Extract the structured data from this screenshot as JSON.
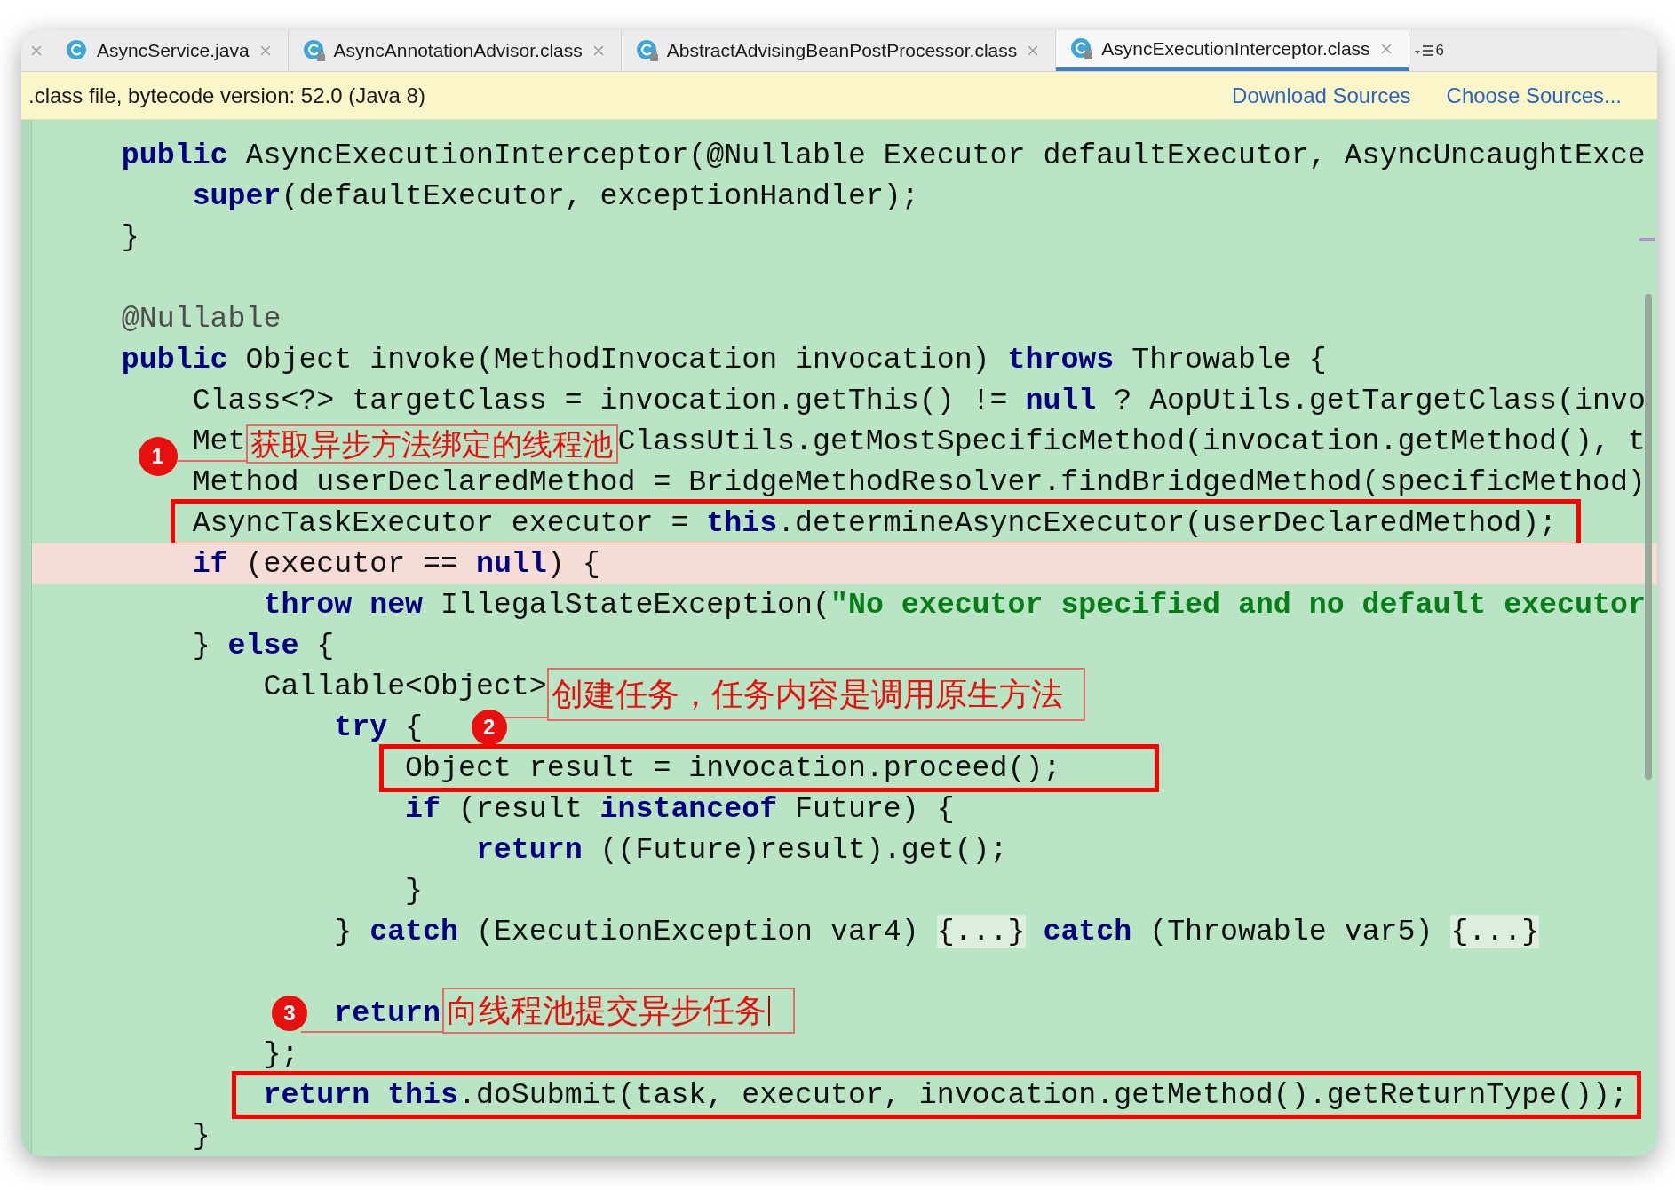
{
  "tabs": [
    {
      "label": "AsyncService.java",
      "selected": false,
      "locked": false
    },
    {
      "label": "AsyncAnnotationAdvisor.class",
      "selected": false,
      "locked": true
    },
    {
      "label": "AbstractAdvisingBeanPostProcessor.class",
      "selected": false,
      "locked": true
    },
    {
      "label": "AsyncExecutionInterceptor.class",
      "selected": true,
      "locked": true
    }
  ],
  "hidden_tab_count": "6",
  "info_bar": {
    "message": ".class file, bytecode version: 52.0 (Java 8)",
    "links": [
      "Download Sources",
      "Choose Sources..."
    ]
  },
  "code_lines": [
    {
      "highlighted": false,
      "boxed": false,
      "tokens": [
        {
          "kind": "kw",
          "text": "    public"
        },
        {
          "kind": "plain",
          "text": " AsyncExecutionInterceptor(@Nullable Executor defaultExecutor, AsyncUncaughtExce"
        }
      ]
    },
    {
      "highlighted": false,
      "boxed": false,
      "tokens": [
        {
          "kind": "kw",
          "text": "        super"
        },
        {
          "kind": "plain",
          "text": "(defaultExecutor, exceptionHandler);"
        }
      ]
    },
    {
      "highlighted": false,
      "boxed": false,
      "tokens": [
        {
          "kind": "plain",
          "text": "    }"
        }
      ]
    },
    {
      "kind": "blank"
    },
    {
      "highlighted": false,
      "boxed": false,
      "tokens": [
        {
          "kind": "ann",
          "text": "    @Nullable"
        }
      ]
    },
    {
      "highlighted": false,
      "boxed": false,
      "tokens": [
        {
          "kind": "kw",
          "text": "    public"
        },
        {
          "kind": "plain",
          "text": " Object invoke(MethodInvocation invocation) "
        },
        {
          "kind": "kw",
          "text": "throws"
        },
        {
          "kind": "plain",
          "text": " Throwable {"
        }
      ]
    },
    {
      "highlighted": false,
      "boxed": false,
      "tokens": [
        {
          "kind": "plain",
          "text": "        Class<?> targetClass = invocation.getThis() != "
        },
        {
          "kind": "kw",
          "text": "null"
        },
        {
          "kind": "plain",
          "text": " ? AopUtils.getTargetClass(invo"
        }
      ]
    },
    {
      "highlighted": false,
      "boxed": false,
      "tokens": [
        {
          "kind": "plain",
          "text": "        Met"
        },
        {
          "kind": "callout",
          "number": "1",
          "text": "获取异步方法绑定的线程池",
          "cursor": false
        },
        {
          "kind": "plain",
          "text": "ClassUtils.getMostSpecificMethod(invocation.getMethod(), t"
        }
      ]
    },
    {
      "highlighted": false,
      "boxed": false,
      "tokens": [
        {
          "kind": "plain",
          "text": "        Method userDeclaredMethod = BridgeMethodResolver.findBridgedMethod(specificMethod)"
        }
      ]
    },
    {
      "highlighted": false,
      "boxed": true,
      "tokens": [
        {
          "kind": "plain",
          "text": "        AsyncTaskExecutor executor = "
        },
        {
          "kind": "kw",
          "text": "this"
        },
        {
          "kind": "plain",
          "text": ".determineAsyncExecutor(userDeclaredMethod);"
        }
      ]
    },
    {
      "highlighted": true,
      "boxed": false,
      "tokens": [
        {
          "kind": "kw",
          "text": "        if"
        },
        {
          "kind": "plain",
          "text": " (executor == "
        },
        {
          "kind": "kw",
          "text": "null"
        },
        {
          "kind": "plain",
          "text": ") {"
        }
      ]
    },
    {
      "highlighted": false,
      "boxed": false,
      "tokens": [
        {
          "kind": "kw",
          "text": "            throw new"
        },
        {
          "kind": "plain",
          "text": " IllegalStateException("
        },
        {
          "kind": "str",
          "text": "\"No executor specified and no default executor"
        }
      ]
    },
    {
      "highlighted": false,
      "boxed": false,
      "tokens": [
        {
          "kind": "plain",
          "text": "        } "
        },
        {
          "kind": "kw",
          "text": "else"
        },
        {
          "kind": "plain",
          "text": " {"
        }
      ]
    },
    {
      "highlighted": false,
      "boxed": false,
      "tokens": [
        {
          "kind": "plain",
          "text": "            Callable<Object>"
        },
        {
          "kind": "callout",
          "number": "2",
          "text": "创建任务，任务内容是调用原生方法",
          "cursor": false
        }
      ]
    },
    {
      "highlighted": false,
      "boxed": false,
      "tokens": [
        {
          "kind": "kw",
          "text": "                try"
        },
        {
          "kind": "plain",
          "text": " {"
        }
      ]
    },
    {
      "highlighted": false,
      "boxed": true,
      "tokens": [
        {
          "kind": "plain",
          "text": "                    Object result = invocation.proceed();"
        }
      ]
    },
    {
      "highlighted": false,
      "boxed": false,
      "tokens": [
        {
          "kind": "kw",
          "text": "                    if"
        },
        {
          "kind": "plain",
          "text": " (result "
        },
        {
          "kind": "kw",
          "text": "instanceof"
        },
        {
          "kind": "plain",
          "text": " Future) {"
        }
      ]
    },
    {
      "highlighted": false,
      "boxed": false,
      "tokens": [
        {
          "kind": "kw",
          "text": "                        return"
        },
        {
          "kind": "plain",
          "text": " ((Future)result).get();"
        }
      ]
    },
    {
      "highlighted": false,
      "boxed": false,
      "tokens": [
        {
          "kind": "plain",
          "text": "                    }"
        }
      ]
    },
    {
      "highlighted": false,
      "boxed": false,
      "tokens": [
        {
          "kind": "plain",
          "text": "                } "
        },
        {
          "kind": "kw",
          "text": "catch"
        },
        {
          "kind": "plain",
          "text": " (ExecutionException var4) "
        },
        {
          "kind": "fold",
          "text": "{...}"
        },
        {
          "kind": "kw",
          "text": " catch"
        },
        {
          "kind": "plain",
          "text": " (Throwable var5) "
        },
        {
          "kind": "fold",
          "text": "{...}"
        }
      ]
    },
    {
      "kind": "blank"
    },
    {
      "highlighted": false,
      "boxed": false,
      "tokens": [
        {
          "kind": "kw",
          "text": "                return"
        },
        {
          "kind": "callout",
          "number": "3",
          "text": "向线程池提交异步任务",
          "cursor": true
        }
      ]
    },
    {
      "highlighted": false,
      "boxed": false,
      "tokens": [
        {
          "kind": "plain",
          "text": "            };"
        }
      ]
    },
    {
      "highlighted": false,
      "boxed": true,
      "tokens": [
        {
          "kind": "kw",
          "text": "            return this"
        },
        {
          "kind": "plain",
          "text": ".doSubmit(task, executor, invocation.getMethod().getReturnType());"
        }
      ]
    },
    {
      "highlighted": false,
      "boxed": false,
      "tokens": [
        {
          "kind": "plain",
          "text": "        }"
        }
      ]
    }
  ]
}
